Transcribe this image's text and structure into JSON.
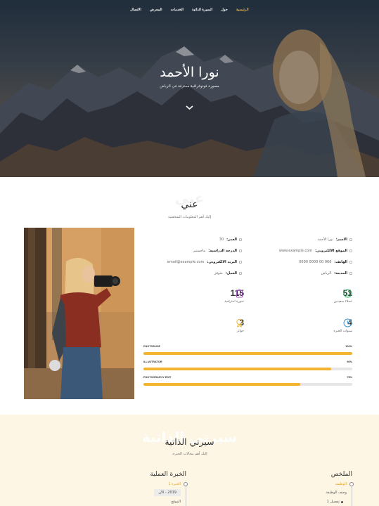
{
  "nav": {
    "items": [
      "الرئيسية",
      "حول",
      "السيرة الذاتية",
      "الخدمات",
      "المعرض",
      "الاتصال"
    ]
  },
  "hero": {
    "title": "نورا الأحمد",
    "subtitle": "مصورة فوتوغرافية محترفة في الرياض"
  },
  "about": {
    "ghost": "عني",
    "title": "عني",
    "subtitle": "إليك أهم المعلومات الشخصية",
    "info_right": [
      {
        "key": "الاسم:",
        "value": "نورا الأحمد"
      },
      {
        "key": "الموقع الالكتروني:",
        "value": "www.example.com"
      },
      {
        "key": "الهاتف:",
        "value": "966 00 0000 0000"
      },
      {
        "key": "المدينة:",
        "value": "الرياض"
      }
    ],
    "info_left": [
      {
        "key": "العمر:",
        "value": "30"
      },
      {
        "key": "الدرجة الدراسية:",
        "value": "ماجستير"
      },
      {
        "key": "البريد الالكتروني:",
        "value": "email@example.com"
      },
      {
        "key": "العمل:",
        "value": "متوفر"
      }
    ],
    "stats": [
      {
        "num": "51",
        "label": "عملاء سعيدين",
        "icon": "smile-icon"
      },
      {
        "num": "115",
        "label": "صورة احترافية",
        "icon": "clipboard-icon"
      },
      {
        "num": "4",
        "label": "سنوات الخبرة",
        "icon": "clock-icon"
      },
      {
        "num": "3",
        "label": "جوائز",
        "icon": "award-icon"
      }
    ],
    "skills": [
      {
        "name": "PHOTOSHOP",
        "percent": "100%",
        "value": 100
      },
      {
        "name": "ILLUSTRATOR",
        "percent": "90%",
        "value": 90
      },
      {
        "name": "PHOTOGRAPHY EDIT",
        "percent": "75%",
        "value": 75
      }
    ]
  },
  "resume": {
    "ghost": "سيرتي الذاتية",
    "title": "سيرتي الذاتية",
    "subtitle": "إليك أهم مجالات الخبرة.",
    "summary_title": "الملخص",
    "experience_title": "الخبرة العملية",
    "summary_job": "الوظيفة",
    "summary_desc": "وصف الوظيفة",
    "summary_bullet": "تفصيل 1",
    "exp_role": "الخبرة 1",
    "exp_years": "2019 - الآن",
    "exp_place": "الموقع"
  },
  "colors": {
    "accent": "#f2b431",
    "resume_bg": "#fdf6e4"
  }
}
